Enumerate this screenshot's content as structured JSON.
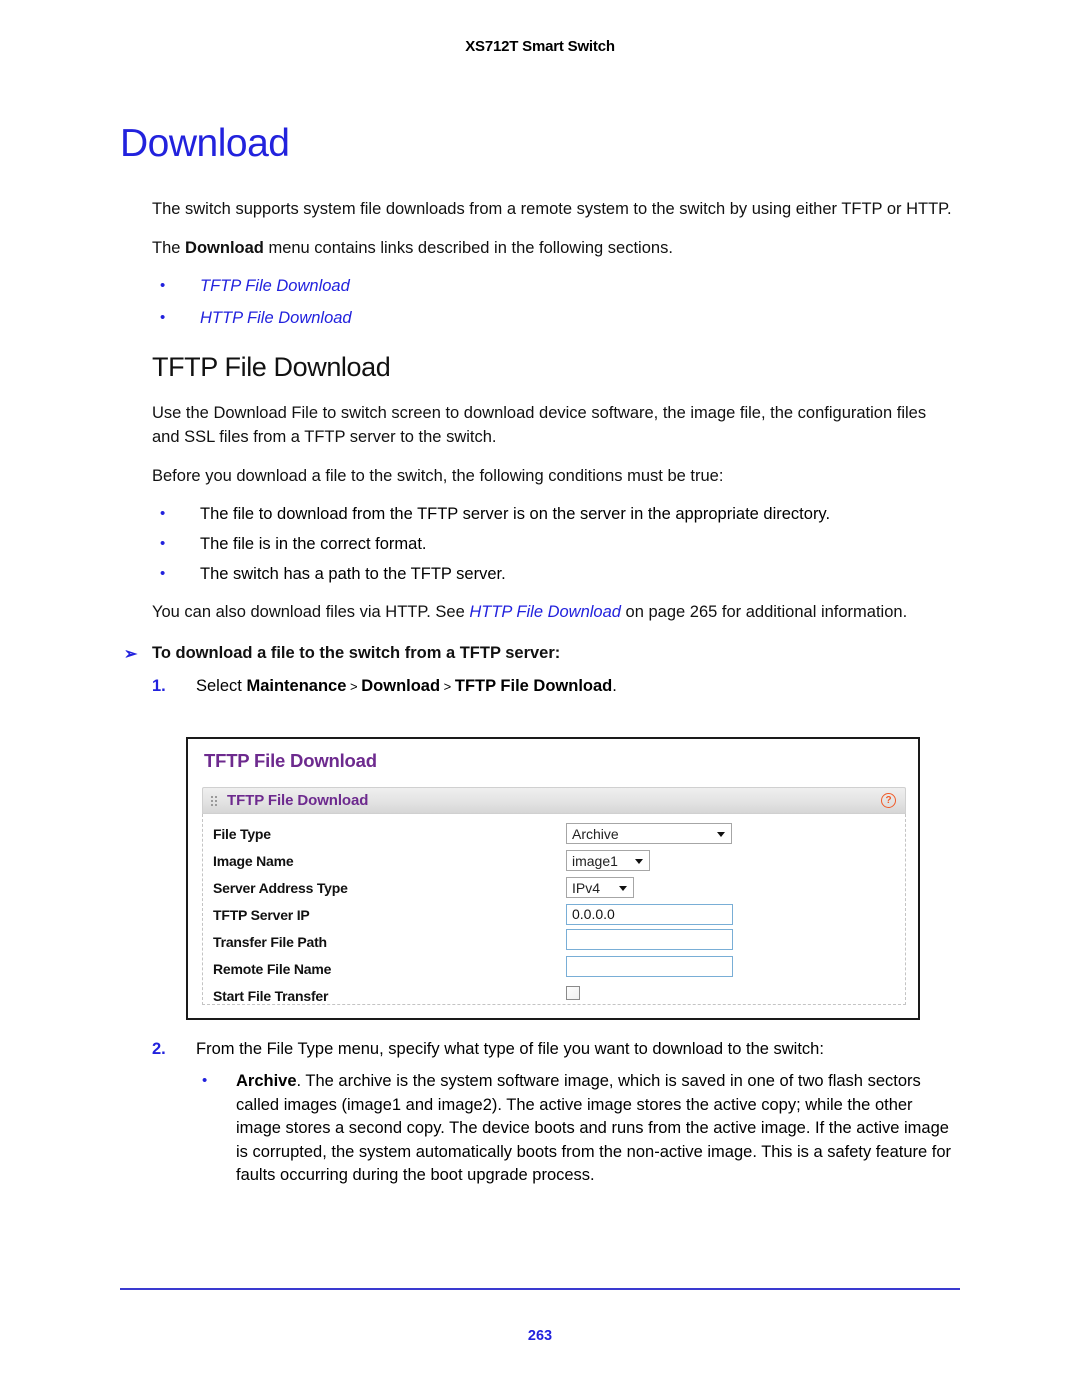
{
  "header": {
    "running_title": "XS712T Smart Switch"
  },
  "chapter": {
    "title": "Download"
  },
  "intro": {
    "para1": "The switch supports system file downloads from a remote system to the switch by using either TFTP or HTTP.",
    "para2_pre": "The ",
    "para2_bold": "Download",
    "para2_post": " menu contains links described in the following sections.",
    "links": [
      {
        "label": "TFTP File Download",
        "bullet": "•"
      },
      {
        "label": "HTTP File Download",
        "bullet": "•"
      }
    ]
  },
  "section": {
    "heading": "TFTP File Download",
    "para1": "Use the Download File to switch screen to download device software, the image file, the configuration files and SSL files from a TFTP server to the switch.",
    "para2": "Before you download a file to the switch, the following conditions must be true:",
    "conditions": [
      "The file to download from the TFTP server is on the server in the appropriate directory.",
      "The file is in the correct format.",
      "The switch has a path to the TFTP server."
    ],
    "crossref_pre": "You can also download files via HTTP. See ",
    "crossref_link": "HTTP File Download",
    "crossref_post": " on page 265 for additional information."
  },
  "procedure": {
    "arrow": "➢",
    "heading": "To download a file to the switch from a TFTP server:",
    "steps": [
      {
        "num": "1.",
        "pre": "Select ",
        "menu": [
          "Maintenance",
          "Download",
          "TFTP File Download"
        ],
        "separator": ">",
        "post": "."
      },
      {
        "num": "2.",
        "text": "From the File Type menu, specify what type of file you want to download to the switch:",
        "subitems": [
          {
            "bullet": "•",
            "bold": "Archive",
            "text": ". The archive is the system software image, which is saved in one of two flash sectors called images (image1 and image2). The active image stores the active copy; while the other image stores a second copy. The device boots and runs from the active image. If the active image is corrupted, the system automatically boots from the non-active image. This is a safety feature for faults occurring during the boot upgrade process."
          }
        ]
      }
    ]
  },
  "ui_screenshot": {
    "page_title": "TFTP File Download",
    "section_title": "TFTP File Download",
    "help_glyph": "?",
    "fields": [
      {
        "label": "File Type",
        "control": "select",
        "value": "Archive",
        "size": "w-lg"
      },
      {
        "label": "Image Name",
        "control": "select",
        "value": "image1",
        "size": "w-md"
      },
      {
        "label": "Server Address Type",
        "control": "select",
        "value": "IPv4",
        "size": "w-sm"
      },
      {
        "label": "TFTP Server IP",
        "control": "text",
        "value": "0.0.0.0"
      },
      {
        "label": "Transfer File Path",
        "control": "text",
        "value": ""
      },
      {
        "label": "Remote File Name",
        "control": "text",
        "value": ""
      },
      {
        "label": "Start File Transfer",
        "control": "checkbox",
        "value": ""
      }
    ]
  },
  "footer": {
    "page_number": "263"
  },
  "colors": {
    "link_blue": "#2222dd",
    "heading_blue": "#2222dd",
    "panel_purple": "#6d2a8e",
    "help_orange": "#f05a28",
    "input_border_blue": "#79aed6"
  }
}
